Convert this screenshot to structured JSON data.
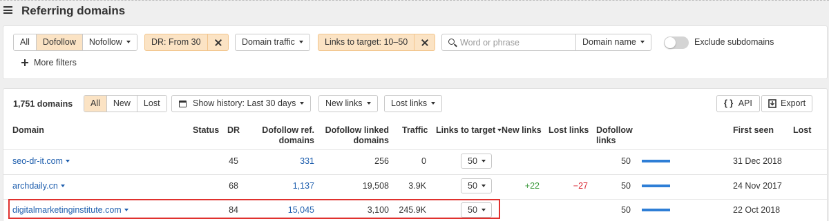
{
  "page": {
    "title": "Referring domains"
  },
  "filters": {
    "link_type": [
      "All",
      "Dofollow",
      "Nofollow"
    ],
    "link_type_active": "Dofollow",
    "dr_chip": "DR: From 30",
    "domain_traffic": "Domain traffic",
    "links_to_target_chip": "Links to target: 10–50",
    "search_placeholder": "Word or phrase",
    "search_mode": "Domain name",
    "exclude_subdomains": "Exclude subdomains",
    "more_filters": "More filters"
  },
  "results": {
    "count": "1,751 domains",
    "tabs": [
      "All",
      "New",
      "Lost"
    ],
    "active_tab": "All",
    "history": "Show history: Last 30 days",
    "new_links": "New links",
    "lost_links": "Lost links",
    "api": "API",
    "api_glyph": "{ }",
    "export": "Export"
  },
  "table": {
    "columns": {
      "domain": "Domain",
      "status": "Status",
      "dr": "DR",
      "dofollow_ref_domains": "Dofollow ref. domains",
      "dofollow_linked_domains": "Dofollow linked domains",
      "traffic": "Traffic",
      "links_to_target": "Links to target",
      "new_links": "New links",
      "lost_links": "Lost links",
      "dofollow_links": "Dofollow links",
      "first_seen": "First seen",
      "lost": "Lost"
    },
    "rows": [
      {
        "domain": "seo-dr-it.com",
        "status": "",
        "dr": "45",
        "ref_domains": "331",
        "linked_domains": "256",
        "traffic": "0",
        "links_to_target": "50",
        "new_links": "",
        "lost_links": "",
        "dofollow_links": "50",
        "dofollow_links_fraction": 0.75,
        "first_seen": "31 Dec 2018",
        "lost": ""
      },
      {
        "domain": "archdaily.cn",
        "status": "",
        "dr": "68",
        "ref_domains": "1,137",
        "linked_domains": "19,508",
        "traffic": "3.9K",
        "links_to_target": "50",
        "new_links": "+22",
        "lost_links": "−27",
        "dofollow_links": "50",
        "dofollow_links_fraction": 0.75,
        "first_seen": "24 Nov 2017",
        "lost": ""
      },
      {
        "domain": "digitalmarketinginstitute.com",
        "status": "",
        "dr": "84",
        "ref_domains": "15,045",
        "linked_domains": "3,100",
        "traffic": "245.9K",
        "links_to_target": "50",
        "new_links": "",
        "lost_links": "",
        "dofollow_links": "50",
        "dofollow_links_fraction": 0.75,
        "first_seen": "22 Oct 2018",
        "lost": ""
      }
    ]
  },
  "colors": {
    "accent_chip": "#fbe3c4",
    "link": "#1f5fae",
    "bar": "#2e7ed6",
    "positive": "#3c9a3c",
    "negative": "#d9232e",
    "highlight": "#e0312e"
  }
}
